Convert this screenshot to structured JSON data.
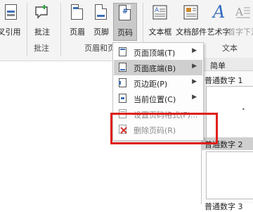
{
  "ribbon": {
    "cross_ref_label": "叉引用",
    "comment_label": "批注",
    "header_label": "页眉",
    "footer_label": "页脚",
    "page_number_label": "页码",
    "textbox_label": "文本框",
    "doc_parts_label": "文档部件",
    "wordart_label": "艺术字",
    "dropcap_label": "首字下沉",
    "groups": {
      "comment": "批注",
      "header_footer": "页眉和页脚",
      "text": "文本"
    }
  },
  "menu": {
    "items": [
      {
        "label": "页面顶端(T)",
        "has_arrow": true
      },
      {
        "label": "页面底端(B)",
        "has_arrow": true
      },
      {
        "label": "页边距(P)",
        "has_arrow": true
      },
      {
        "label": "当前位置(C)",
        "has_arrow": true
      },
      {
        "label": "设置页码格式(F)...",
        "has_arrow": false
      },
      {
        "label": "删除页码(R)",
        "has_arrow": false
      }
    ]
  },
  "gallery": {
    "header": "简单",
    "items": [
      "普通数字 1",
      "普通数字 2",
      "普通数字 3"
    ],
    "thumb_glyph": "•"
  },
  "colors": {
    "accent": "#3d6fb6",
    "highlight_box": "#e0201b",
    "wordart": "#2f6bbf"
  }
}
